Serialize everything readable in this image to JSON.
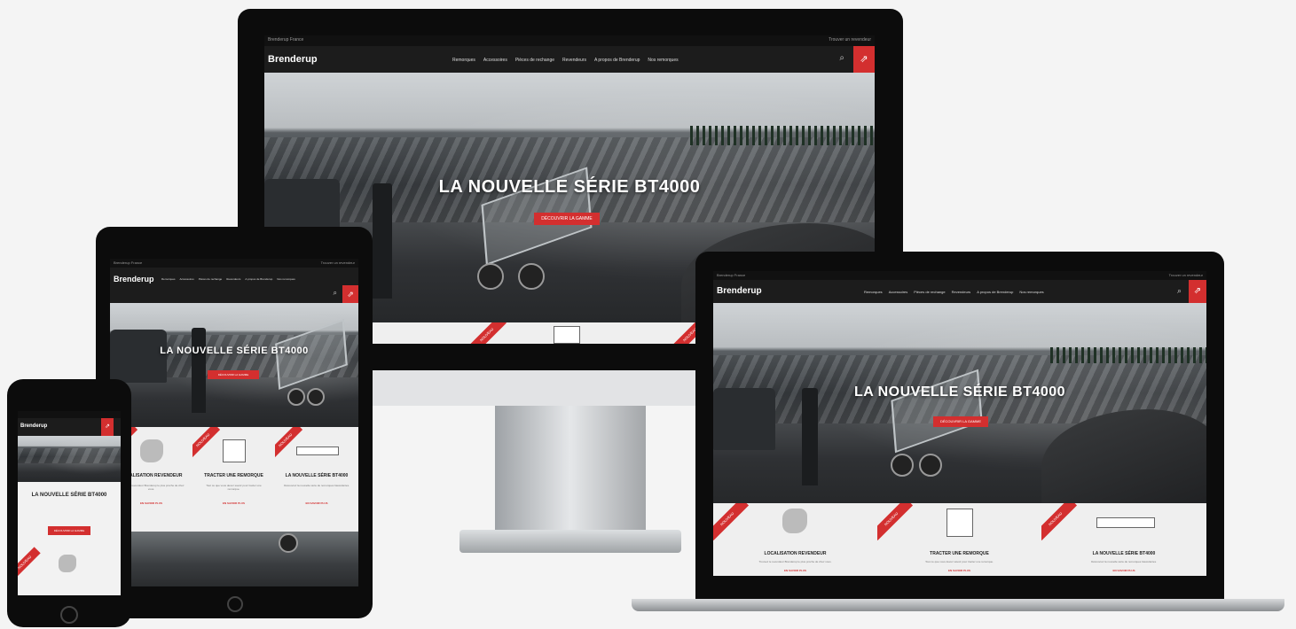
{
  "brand": "Brenderup",
  "topbar": {
    "left": "Brenderup France",
    "right": "Trouver un revendeur"
  },
  "nav": [
    "Remorques",
    "Accessoires",
    "Pièces de rechange",
    "Revendeurs",
    "A propos de Brenderup",
    "Nos remorques"
  ],
  "hero": {
    "title": "LA NOUVELLE SÉRIE BT4000",
    "title_short": "LA NOUVELLE SÉRIE BT4000",
    "button": "DÉCOUVRIR LA GAMME"
  },
  "cards": [
    {
      "ribbon": "NOUVEAU",
      "title": "LOCALISATION REVENDEUR",
      "text": "Trouvez le revendeur Brenderup le plus proche de chez vous.",
      "link": "EN SAVOIR PLUS",
      "icon": "france-map-icon"
    },
    {
      "ribbon": "NOUVEAU",
      "title": "TRACTER UNE REMORQUE",
      "text": "Tout ce que vous devez savoir pour tracter une remorque.",
      "link": "EN SAVOIR PLUS",
      "icon": "box-trailer-icon"
    },
    {
      "ribbon": "NOUVEAU",
      "title": "LA NOUVELLE SÉRIE BT4000",
      "text": "Découvrez la nouvelle série de remorques basculantes.",
      "link": "EN SAVOIR PLUS",
      "icon": "flatbed-trailer-icon"
    }
  ],
  "colors": {
    "accent": "#d32f2f",
    "nav": "#1c1c1c",
    "bezel": "#0c0c0c"
  }
}
